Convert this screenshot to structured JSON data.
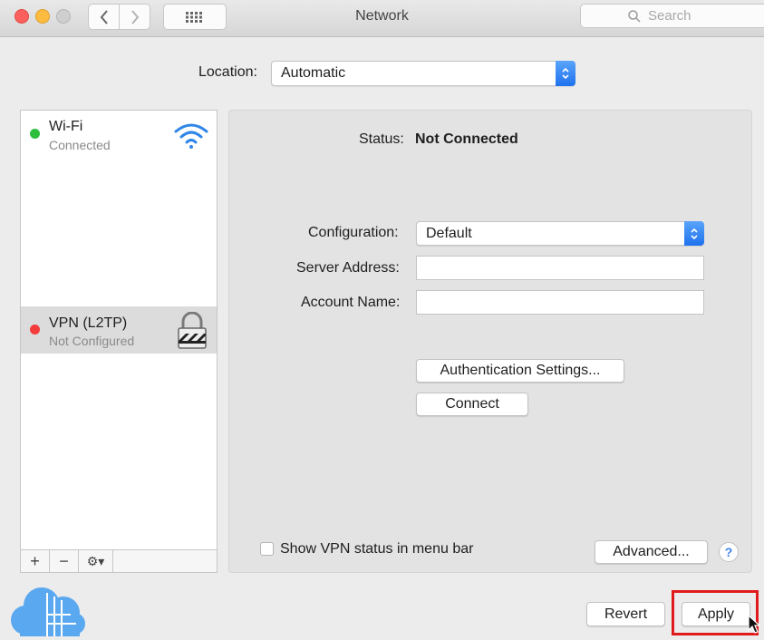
{
  "window": {
    "title": "Network",
    "search_placeholder": "Search"
  },
  "location": {
    "label": "Location:",
    "value": "Automatic"
  },
  "services": [
    {
      "name": "Wi-Fi",
      "status": "Connected",
      "status_color": "#2dbe3c",
      "icon": "wifi-icon"
    },
    {
      "name": "VPN (L2TP)",
      "status": "Not Configured",
      "status_color": "#f33c3c",
      "icon": "lock-icon"
    }
  ],
  "sidebar_tools": {
    "add": "+",
    "remove": "−",
    "action": "⚙▾"
  },
  "detail": {
    "status_label": "Status:",
    "status_value": "Not Connected",
    "configuration_label": "Configuration:",
    "configuration_value": "Default",
    "server_label": "Server Address:",
    "server_value": "",
    "account_label": "Account Name:",
    "account_value": "",
    "auth_button": "Authentication Settings...",
    "connect_button": "Connect",
    "show_status_label": "Show VPN status in menu bar",
    "show_status_checked": false,
    "advanced_button": "Advanced...",
    "help_button": "?"
  },
  "footer": {
    "revert_button": "Revert",
    "apply_button": "Apply"
  },
  "colors": {
    "accent": "#1e72ed",
    "highlight": "#e11b1b"
  }
}
